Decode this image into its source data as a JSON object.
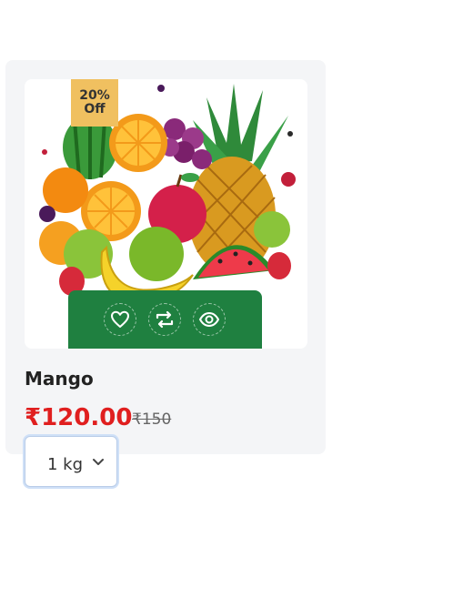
{
  "product": {
    "badge_percent": "20%",
    "badge_label": "Off",
    "name": "Mango",
    "price": "₹120.00",
    "old_price": "₹150",
    "quantity_selected": "1 kg"
  },
  "actions": [
    {
      "icon": "heart-icon"
    },
    {
      "icon": "compare-icon"
    },
    {
      "icon": "eye-icon"
    }
  ],
  "colors": {
    "card_bg": "#f4f5f7",
    "actions_bg": "#1f8040",
    "badge_bg": "#f0c060",
    "price": "#e01f1f"
  }
}
